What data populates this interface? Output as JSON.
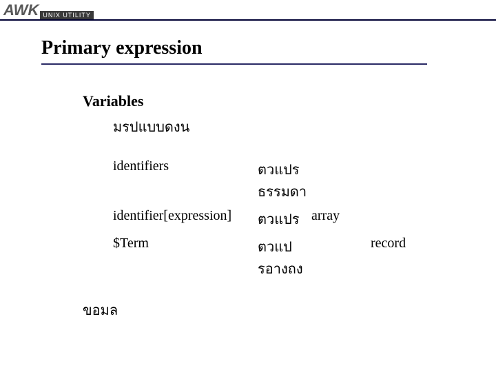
{
  "logo": {
    "main": "AWK",
    "sub": "UNIX UTILITY"
  },
  "title": "Primary expression",
  "section": {
    "heading": "Variables",
    "subtext": "มรปแบบดงน"
  },
  "rows": [
    {
      "c1": "identifiers",
      "c2": "ตวแปรธรรมดา",
      "c3": "",
      "c4": ""
    },
    {
      "c1": "identifier[expression]",
      "c2": "ตวแปร",
      "c3": "array",
      "c4": ""
    },
    {
      "c1": "$Term",
      "c2": "ตวแปรอางถง",
      "c3": "",
      "c4": "record"
    }
  ],
  "footer": "ขอมล"
}
